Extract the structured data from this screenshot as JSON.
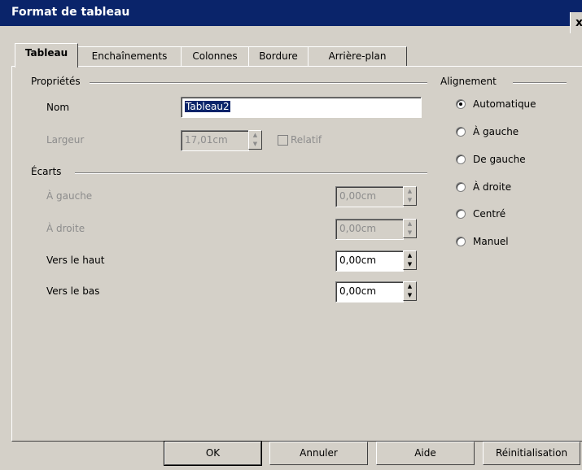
{
  "window": {
    "title": "Format de tableau",
    "close_label": "x"
  },
  "tabs": [
    {
      "label": "Tableau",
      "active": true
    },
    {
      "label": "Enchaînements"
    },
    {
      "label": "Colonnes"
    },
    {
      "label": "Bordure"
    },
    {
      "label": "Arrière-plan"
    }
  ],
  "properties": {
    "section_label": "Propriétés",
    "name_label": "Nom",
    "name_value": "Tableau2",
    "width_label": "Largeur",
    "width_value": "17,01cm",
    "relative_label": "Relatif"
  },
  "spacing": {
    "section_label": "Écarts",
    "left_label": "À gauche",
    "left_value": "0,00cm",
    "right_label": "À droite",
    "right_value": "0,00cm",
    "top_label": "Vers le haut",
    "top_value": "0,00cm",
    "bottom_label": "Vers le bas",
    "bottom_value": "0,00cm"
  },
  "alignment": {
    "section_label": "Alignement",
    "options": [
      {
        "label": "Automatique",
        "selected": true
      },
      {
        "label": "À gauche"
      },
      {
        "label": "De gauche"
      },
      {
        "label": "À droite"
      },
      {
        "label": "Centré"
      },
      {
        "label": "Manuel"
      }
    ]
  },
  "buttons": {
    "ok": "OK",
    "cancel": "Annuler",
    "help": "Aide",
    "reset": "Réinitialisation"
  }
}
